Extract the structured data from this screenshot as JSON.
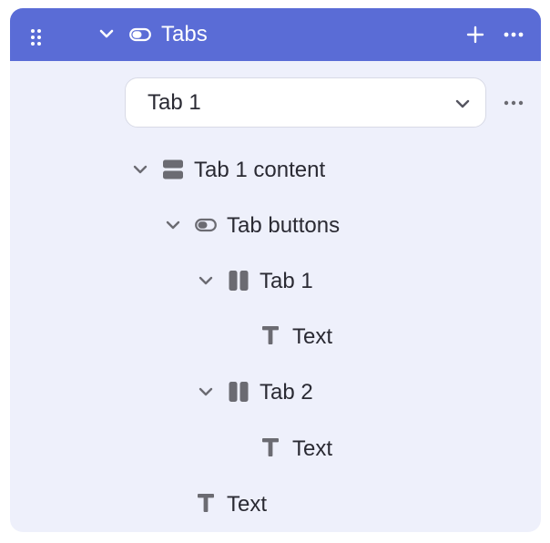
{
  "header": {
    "title": "Tabs",
    "drag_handle_icon": "drag-handle-icon",
    "collapse_icon": "chevron-down-icon",
    "component_icon": "tabs-component-icon",
    "add_icon": "plus-icon",
    "more_icon": "more-horizontal-icon",
    "background_color": "#5a6cd6"
  },
  "active_tab_select": {
    "value": "Tab 1",
    "icon": "chevron-down-icon"
  },
  "tree": [
    {
      "label": "Tab 1 content",
      "icon": "stack-icon",
      "expanded": true
    },
    {
      "label": "Tab buttons",
      "icon": "toggle-button-icon",
      "expanded": true
    },
    {
      "label": "Tab 1",
      "icon": "columns-icon",
      "expanded": true
    },
    {
      "label": "Text",
      "icon": "text-icon"
    },
    {
      "label": "Tab 2",
      "icon": "columns-icon",
      "expanded": true
    },
    {
      "label": "Text",
      "icon": "text-icon"
    },
    {
      "label": "Text",
      "icon": "text-icon"
    }
  ],
  "colors": {
    "panel_background": "#eef0fb",
    "text": "#2a2a33",
    "icon_gray": "#6b6b72"
  }
}
